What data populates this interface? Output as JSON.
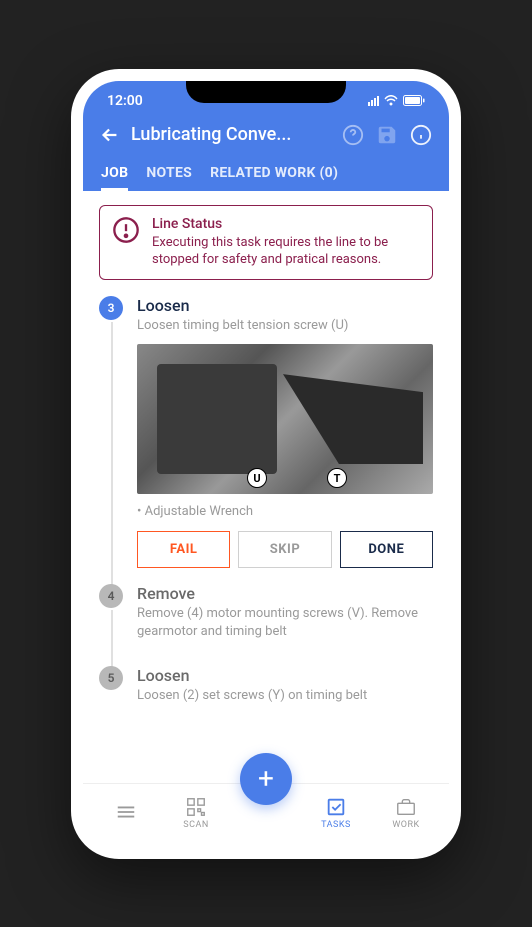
{
  "status": {
    "time": "12:00"
  },
  "header": {
    "title": "Lubricating Conve..."
  },
  "tabs": [
    {
      "label": "JOB",
      "active": true
    },
    {
      "label": "NOTES",
      "active": false
    },
    {
      "label": "RELATED WORK (0)",
      "active": false
    }
  ],
  "alert": {
    "title": "Line Status",
    "body": "Executing this task requires the line to be stopped for safety and pratical reasons."
  },
  "steps": [
    {
      "num": "3",
      "active": true,
      "title": "Loosen",
      "desc": "Loosen timing belt tension screw (U)",
      "tool": "• Adjustable Wrench",
      "image_labels": [
        "U",
        "T"
      ],
      "actions": {
        "fail": "FAIL",
        "skip": "SKIP",
        "done": "DONE"
      }
    },
    {
      "num": "4",
      "active": false,
      "title": "Remove",
      "desc": "Remove (4) motor mounting screws (V). Remove gearmotor and timing belt"
    },
    {
      "num": "5",
      "active": false,
      "title": "Loosen",
      "desc": "Loosen (2) set screws (Y) on timing belt"
    }
  ],
  "fab": "+",
  "nav": {
    "menu": "",
    "scan": "SCAN",
    "tasks": "TASKS",
    "work": "WORK"
  }
}
